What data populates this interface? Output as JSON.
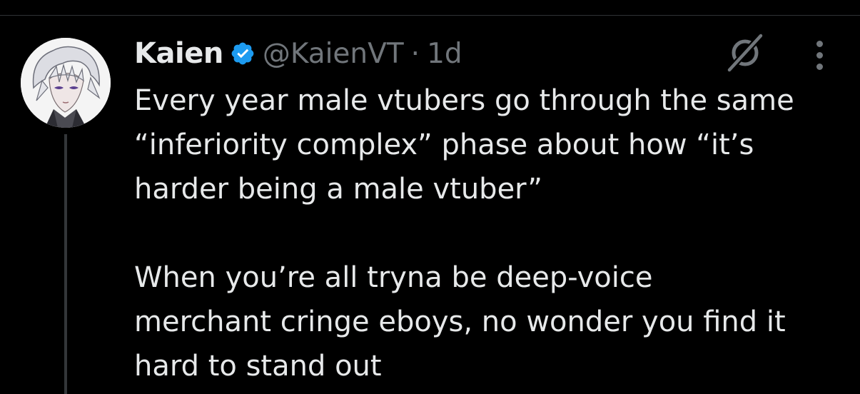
{
  "tweet": {
    "display_name": "Kaien",
    "verified": true,
    "handle": "@KaienVT",
    "separator": "·",
    "time": "1d",
    "paragraphs": [
      "Every year male vtubers go through the same\n“inferiority complex” phase about how “it’s\nharder being a male vtuber”",
      "When you’re all tryna be deep-voice\nmerchant cringe eboys, no wonder you find it\nhard to stand out"
    ]
  },
  "icons": {
    "verified": "verified-badge-icon",
    "grok": "grok-icon",
    "more": "more-options-icon"
  },
  "colors": {
    "background": "#000000",
    "text": "#e7e9ea",
    "secondary": "#71767b",
    "verified": "#1d9bf0",
    "divider": "#2f3336"
  }
}
